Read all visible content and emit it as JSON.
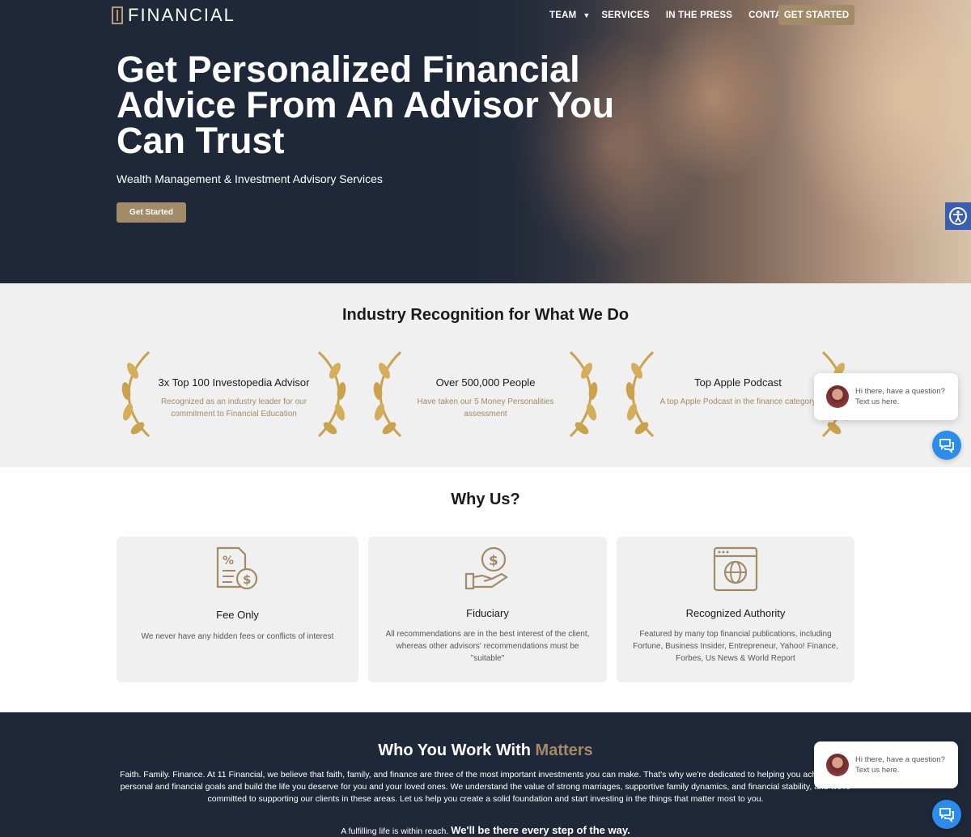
{
  "header": {
    "logo_text": "FINANCIAL",
    "nav": [
      "TEAM",
      "SERVICES",
      "IN THE PRESS",
      "CONTACT"
    ],
    "cta": "GET STARTED"
  },
  "hero": {
    "title": "Get Personalized Financial Advice From An Advisor You Can Trust",
    "subtitle": "Wealth Management & Investment Advisory Services",
    "button": "Get Started"
  },
  "recognition": {
    "title": "Industry Recognition for What We Do",
    "awards": [
      {
        "name": "3x Top 100 Investopedia Advisor",
        "desc": "Recognized as an industry leader for our commitment to Financial Education"
      },
      {
        "name": "Over 500,000 People",
        "desc": "Have taken our 5 Money Personalities assessment"
      },
      {
        "name": "Top Apple Podcast",
        "desc": "A top Apple Podcast in the finance category"
      }
    ]
  },
  "why": {
    "title": "Why Us?",
    "cards": [
      {
        "title": "Fee Only",
        "desc": "We never have any hidden fees or conflicts of interest",
        "icon": "fee-document-icon"
      },
      {
        "title": "Fiduciary",
        "desc": "All recommendations are in the best interest of the client, whereas other advisors' recommendations must be \"suitable\"",
        "icon": "hand-coin-icon"
      },
      {
        "title": "Recognized Authority",
        "desc": "Featured by many top financial publications, including Fortune, Business Insider, Entrepreneur, Yahoo! Finance, Forbes, Us News & World Report",
        "icon": "web-globe-icon"
      }
    ]
  },
  "who": {
    "title_main": "Who You Work With ",
    "title_accent": "Matters",
    "body": "Faith. Family. Finance. At 11 Financial, we believe that faith, family, and finance are three of the most important investments you can make. That's why we're dedicated to helping you achieve your personal and financial goals and build the life you deserve for you and your loved ones. We understand the value of strong marriages, supportive family dynamics, and financial stability, and we're committed to supporting our clients in these areas. Let us help you create a solid foundation and start investing in the things that matter most to you.",
    "tag_plain": "A fulfilling life is within reach. ",
    "tag_bold": "We'll be there every step of the way."
  },
  "chat": {
    "message": "Hi there, have a question? Text us here."
  },
  "colors": {
    "navy": "#1f2838",
    "gold": "#a38a69",
    "light_gray": "#f0f0f0",
    "chat_blue": "#2b8ceb"
  }
}
